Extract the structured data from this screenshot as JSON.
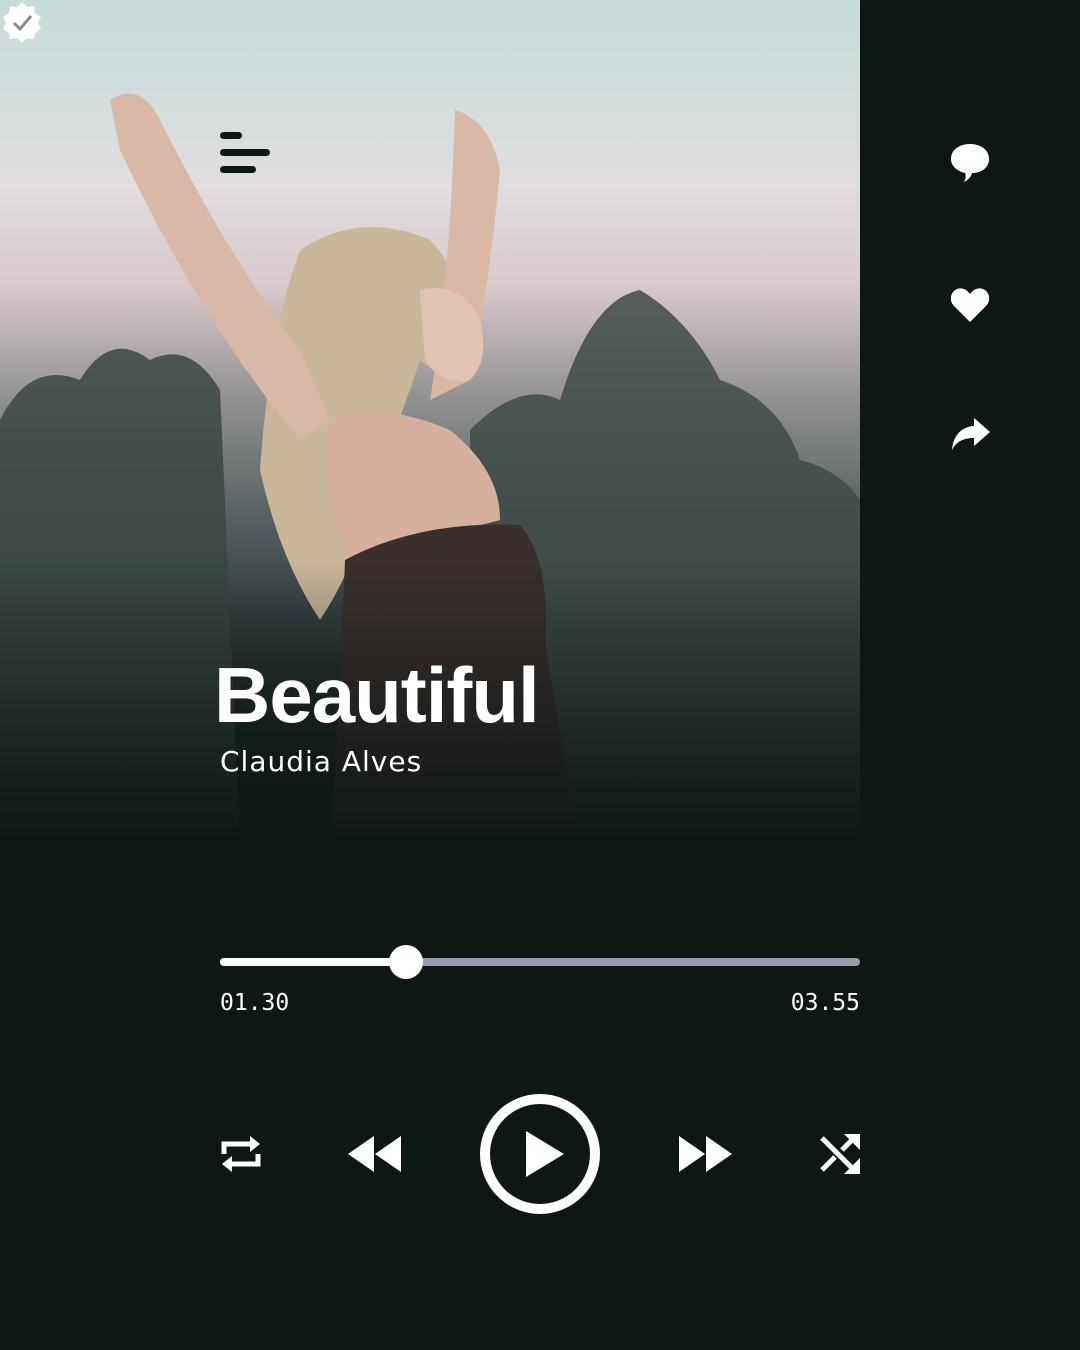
{
  "track": {
    "title": "Beautiful",
    "artist": "Claudia Alves",
    "verified": true
  },
  "playback": {
    "current_time": "01.30",
    "total_time": "03.55",
    "progress_fraction": 0.29
  },
  "icons": {
    "menu": "menu-icon",
    "verified": "verified-badge-icon",
    "comment": "comment-icon",
    "like": "heart-icon",
    "share": "share-icon",
    "repeat": "repeat-icon",
    "previous": "rewind-icon",
    "play": "play-icon",
    "next": "fast-forward-icon",
    "shuffle": "shuffle-icon"
  },
  "colors": {
    "background": "#0f1715",
    "foreground": "#ffffff",
    "track_remaining": "#9c9cb0"
  }
}
